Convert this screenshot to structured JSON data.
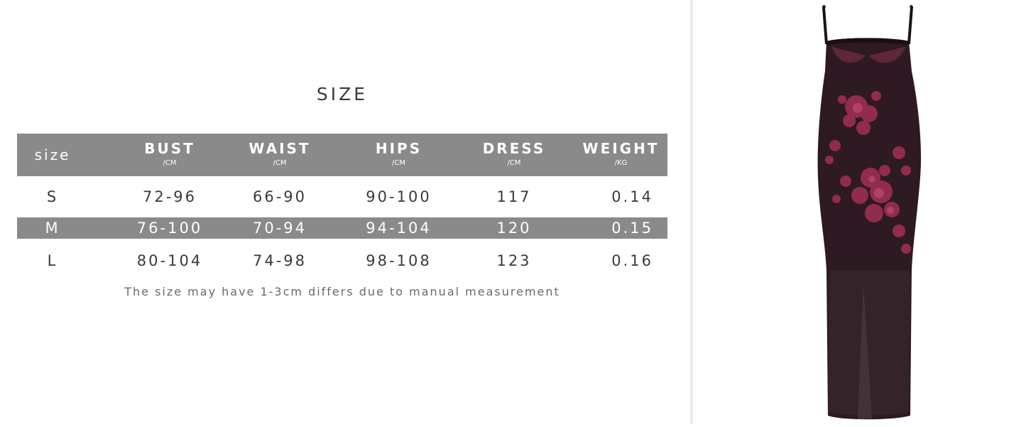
{
  "size_chart": {
    "title": "SIZE",
    "header": {
      "size_label": "size",
      "columns": [
        {
          "name": "BUST",
          "unit": "/CM"
        },
        {
          "name": "WAIST",
          "unit": "/CM"
        },
        {
          "name": "HIPS",
          "unit": "/CM"
        },
        {
          "name": "DRESS",
          "unit": "/CM"
        },
        {
          "name": "WEIGHT",
          "unit": "/KG"
        }
      ]
    },
    "rows": [
      {
        "size": "S",
        "bust": "72-96",
        "waist": "66-90",
        "hips": "90-100",
        "dress": "117",
        "weight": "0.14"
      },
      {
        "size": "M",
        "bust": "76-100",
        "waist": "70-94",
        "hips": "94-104",
        "dress": "120",
        "weight": "0.15"
      },
      {
        "size": "L",
        "bust": "80-104",
        "waist": "74-98",
        "hips": "98-108",
        "dress": "123",
        "weight": "0.16"
      }
    ],
    "footnote": "The size may have 1-3cm differs due to manual measurement"
  },
  "colors": {
    "header_bg": "#8a8a8a",
    "dress_base": "#2e1a22",
    "dress_print": "#9c2f52"
  },
  "product_image": {
    "icon": "slip-dress-image"
  }
}
